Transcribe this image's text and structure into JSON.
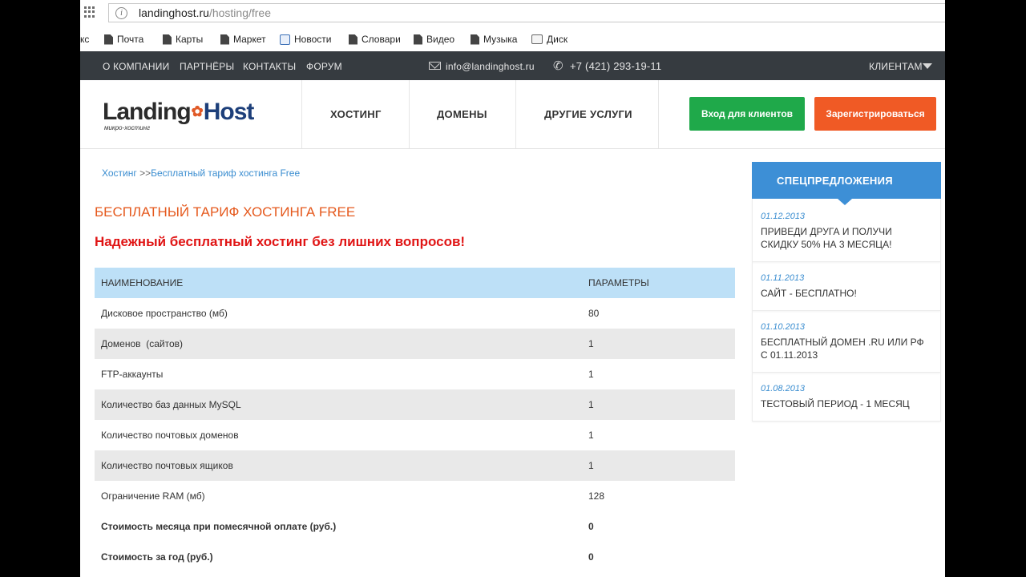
{
  "browser": {
    "url_host": "landinghost.ru",
    "url_path": "/hosting/free",
    "bookmarks": [
      "кс",
      "Почта",
      "Карты",
      "Маркет",
      "Новости",
      "Словари",
      "Видео",
      "Музыка",
      "Диск"
    ]
  },
  "topbar": {
    "links": [
      "О КОМПАНИИ",
      "ПАРТНЁРЫ",
      "КОНТАКТЫ",
      "ФОРУМ"
    ],
    "email": "info@landinghost.ru",
    "phone": "+7 (421) 293-19-11",
    "clients": "КЛИЕНТАМ"
  },
  "header": {
    "logo_part1": "Landing",
    "logo_part2": "Host",
    "logo_tagline": "микро-хостинг",
    "nav": [
      "ХОСТИНГ",
      "ДОМЕНЫ",
      "ДРУГИЕ УСЛУГИ"
    ],
    "login": "Вход для клиентов",
    "register": "Зарегистрироваться"
  },
  "main": {
    "breadcrumb_root": "Хостинг",
    "breadcrumb_sep": ">>",
    "breadcrumb_current": "Бесплатный тариф хостинга Free",
    "title": "БЕСПЛАТНЫЙ ТАРИФ ХОСТИНГА FREE",
    "subtitle": "Надежный бесплатный хостинг без лишних вопросов!",
    "table": {
      "headers": [
        "НАИМЕНОВАНИЕ",
        "ПАРАМЕТРЫ"
      ],
      "rows": [
        [
          "Дисковое пространство (мб)",
          "80"
        ],
        [
          "Доменов  (сайтов)",
          "1"
        ],
        [
          "FTP-аккаунты",
          "1"
        ],
        [
          "Количество баз данных MySQL",
          "1"
        ],
        [
          "Количество почтовых доменов",
          "1"
        ],
        [
          "Количество почтовых ящиков",
          "1"
        ],
        [
          "Ограничение RAM (мб)",
          "128"
        ],
        [
          "Стоимость месяца при помесячной оплате (руб.)",
          "0"
        ],
        [
          "Стоимость за год (руб.)",
          "0"
        ]
      ]
    }
  },
  "sidebar": {
    "title": "СПЕЦПРЕДЛОЖЕНИЯ",
    "items": [
      {
        "date": "01.12.2013",
        "text": "ПРИВЕДИ ДРУГА И ПОЛУЧИ СКИДКУ 50% НА 3 МЕСЯЦА!"
      },
      {
        "date": "01.11.2013",
        "text": "САЙТ - БЕСПЛАТНО!"
      },
      {
        "date": "01.10.2013",
        "text": "БЕСПЛАТНЫЙ ДОМЕН .RU ИЛИ РФ С 01.11.2013"
      },
      {
        "date": "01.08.2013",
        "text": "ТЕСТОВЫЙ ПЕРИОД - 1 МЕСЯЦ"
      }
    ]
  },
  "colors": {
    "accent_orange": "#f05a25",
    "accent_green": "#1fa94a",
    "accent_blue": "#3d8fd6",
    "title_red": "#e01414"
  }
}
